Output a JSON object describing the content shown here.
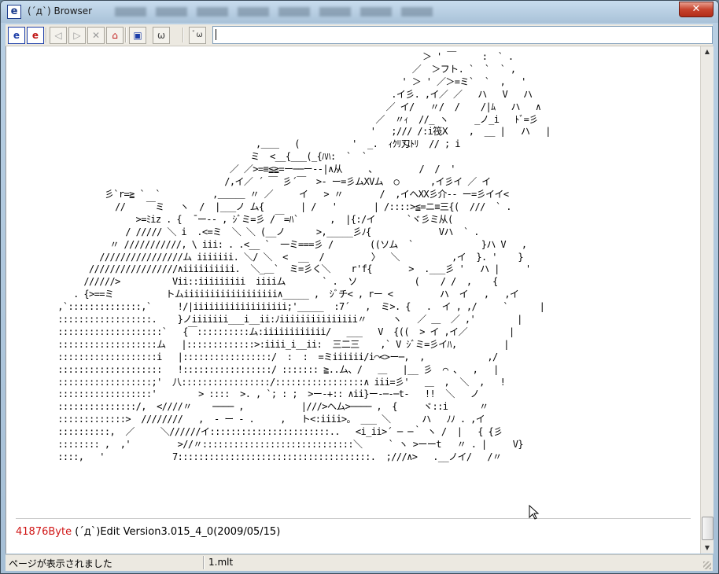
{
  "window": {
    "title": "(´д`) Browser",
    "close_glyph": "✕"
  },
  "toolbar": {
    "buttons": [
      {
        "name": "e-icon-blue",
        "glyph": "e"
      },
      {
        "name": "e-icon-red",
        "glyph": "e"
      },
      {
        "name": "back-icon",
        "glyph": "◁"
      },
      {
        "name": "forward-icon",
        "glyph": "▷"
      },
      {
        "name": "stop-icon",
        "glyph": "✕"
      },
      {
        "name": "home-icon",
        "glyph": "⌂"
      },
      {
        "name": "window-icon",
        "glyph": "▣"
      },
      {
        "name": "face-icon",
        "glyph": "ω"
      },
      {
        "name": "cat-icon",
        "glyph": "ﾞω"
      }
    ],
    "address_value": ""
  },
  "content": {
    "ascii_art": "                                                                        ＞ ' ￣     :  ` .\n                                                                      ／  ＞フト. `  `  ` ,\n                                                                    ' ＞ ' ／＞=ミ`  `  ,   '\n                                                                  .イ彡. ,イ／ ／   ハ   V   ハ\n                                                                 ／ イ/   〃/  /    /|ﾑ   ハ   ∧\n                                                               ／  〃ｨ  //_ ヽ     _ノ_i   ﾄﾞ=彡\n                                                              '   ;/// /:i筏Ⅹ    ,  __ |   ハ   |\n                                        ,＿＿   (          '  _.  ｨｸﾘ刄ﾄﾘ  // ; i\n                                       ミ  <__{___(_{ﾊﾊ:  `  `\n                                   ／ ／>=≡≦≧=ー──ー--|∧从     、        /  /  '\n                                  /,イ／ ´ ￣ 彡´￣  >- ー=彡ムXVム  ○      ,イ彡イ ／ イ\n           彡`r=≧ `  `          ,＿＿＿ 〃 ／     イ   > 〃       /  ,イヘXX彡介-- ー=彡イイ<\n             //    ￣ミ   ヽ  /  |___ノ ム{       | /   '       | /::::>≦=ニ≡三{(  ///  ` .\n                 >=ﾐiz . {  ̄ ー-‐ , ｼﾞミ=彡 /￣=ﾊ`      ,  |{:/イ      `ヾ彡ミ从(\n               / ///// ＼ i  .<=ミ  ＼ ＼ (__ノ      >,_____彡ﾉ{             Vハ  ` .\n            〃 ///////////, \\ iii: . .<__ `  一ミ===彡 /       ((ソム  `             }ハ V   ,\n          ////////////////ム iiiiiii. ＼/ ＼  <  __  /         〉  ＼          ,イ  }. '    }\n        /////////////////∧iiiiiiiiii.  ＼_＿`  ミ=彡く＼    r'f{       >  .___彡 '   ハ |     '\n       //////>          Vii::iiiiiiiii  iiiiム       ` .  ソ           (    / /  ,    {\n     . {>==ミ          トムiiiiiiiiiiiiiiiiii∧_____ ,  ｼﾞチ< , rー <         ハ  イ   ,   ,イ\n  ,`::::::::::::::,`     !/|iiiiiiiiiiiiiiiiii;'_____  :7´   ,  ミ>. {   .  イ , ,/     `      |\n  ::::::::::::::::::.    }ノiiiiiii___i__ii:ﾉiiiiiiiiiiiiiii〃     ヽ   ／ ＿  ／ ,'        |\n  ::::::::::::::::::::`   {￣::::::::::ム:iiiiiiiiiiii/   ___   V  {((  > イ ,イ／        |\n  :::::::::::::::::::ム   |:::::::::::::>:iiii_i__ii:  三二三    ,` V ｼﾞミ=彡イﾊ,         |\n  :::::::::::::::::::i   |:::::::::::::::::/  :  :  =ミiiiiii/i⌒<>ー─,  ,            ,/\n  ::::::::::::::::::::   !:::::::::::::::::/ ::::::: ≧..ム、/   ＿   |__ 彡  ⌒ 、  ,   |\n  ::::::::::::::::::;'  八:::::::::::::::::/:::::::::::::::::∧ iii=彡'   ＿  ,  ＼  ,   !\n  ::::::::::::::::::'        > ::::  >. , `; : ;  >ー-+:: ∧ii}ー-─-─t-   !!  ＼   ノ\n  :::::::::::::::/,  <////〃    ──── ,           |///>ヘム>──── ,  {     ヾ::i      〃\n  :::::::::::::>  ////////   ,  - ー - .     ,   ト<:iiii>。 ___ ＼      ハ   ﾉﾉ . ,イ\n  ::::::::::,  ／     ＼//////イ:::::::::::::::::::::::..   <i_ii>´ ─ ─｀ ヽ /  |   { {彡\n  :::::::: ,  ,'         >//〃:::::::::::::::::::::::::::::＼     ` ヽ >ーーt   〃 . |     V}\n  ::::,   '             7:::::::::::::::::::::::::::::::::::::.  ;///∧>   .__ノイ/   /〃",
    "byte_count": "41876Byte",
    "version_text": " (´д`)Edit Version3.015_4_0(2009/05/15)"
  },
  "statusbar": {
    "left": "ページが表示されました",
    "right": "1.mlt"
  }
}
